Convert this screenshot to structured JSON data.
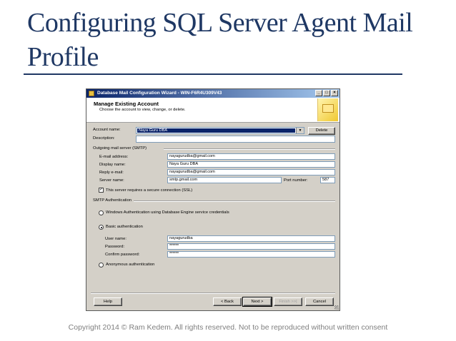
{
  "slide": {
    "title": "Configuring SQL Server Agent Mail Profile",
    "footer": "Copyright 2014 © Ram Kedem. All rights reserved. Not to be reproduced without written consent"
  },
  "window": {
    "title": "Database Mail Configuration Wizard - WIN-F6R4U309V43",
    "controls": {
      "minimize": "_",
      "maximize": "□",
      "close": "×"
    }
  },
  "banner": {
    "title": "Manage Existing Account",
    "subtitle": "Choose the account to view, change, or delete."
  },
  "account": {
    "name_label": "Account name:",
    "name_value": "Naya Guru DBA",
    "delete_label": "Delete",
    "description_label": "Description:",
    "description_value": ""
  },
  "smtp": {
    "group_label": "Outgoing mail server (SMTP)",
    "email_label": "E-mail address:",
    "email_value": "nayagurudba@gmail.com",
    "display_label": "Display name:",
    "display_value": "Naya Guru DBA",
    "reply_label": "Reply e-mail:",
    "reply_value": "nayagurudba@gmail.com",
    "server_label": "Server name:",
    "server_value": "smtp.gmail.com",
    "port_label": "Port number:",
    "port_value": "587",
    "ssl_label": "This server requires a secure connection (SSL)",
    "ssl_checked": true
  },
  "auth": {
    "group_label": "SMTP Authentication",
    "windows_label": "Windows Authentication using Database Engine service credentials",
    "basic_label": "Basic authentication",
    "user_label": "User name:",
    "user_value": "nayagurudba",
    "password_label": "Password:",
    "password_value": "******",
    "confirm_label": "Confirm password:",
    "confirm_value": "******",
    "anonymous_label": "Anonymous authentication",
    "selected": "basic"
  },
  "footer_buttons": {
    "help": "Help",
    "back": "< Back",
    "next": "Next >",
    "finish": "Finish >>|",
    "cancel": "Cancel"
  },
  "colors": {
    "title_blue": "#1f3864",
    "window_face": "#d4d0c8",
    "titlebar_start": "#0a246a",
    "titlebar_end": "#a6caf0"
  }
}
